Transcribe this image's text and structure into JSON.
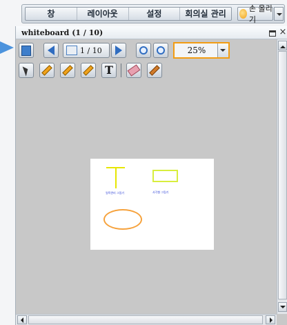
{
  "menu": {
    "items": [
      {
        "label": "창"
      },
      {
        "label": "레이아웃"
      },
      {
        "label": "설정"
      },
      {
        "label": "회의실 관리"
      }
    ],
    "raise_hand_label": "손 올리기"
  },
  "panel": {
    "title": "whiteboard (1 / 10)"
  },
  "toolbar": {
    "page_indicator": "1 / 10",
    "zoom_value": "25%",
    "zoom_highlight_color": "#f39c12",
    "text_tool_glyph": "T"
  },
  "canvas": {
    "labels": {
      "left": "일욕관리 그림기",
      "right": "사각형 그림기"
    },
    "colors": {
      "t_shape": "#e6e600",
      "rectangle": "#d8ee3e",
      "ellipse": "#f6a23c",
      "label_text": "#2b3fd6"
    }
  },
  "icons": {
    "pointer": "arrow-pointer-icon",
    "doc": "document-icon",
    "prev": "prev-page-icon",
    "next": "next-page-icon",
    "zoom_out": "zoom-out-icon",
    "zoom_in": "zoom-in-icon",
    "pen": "pen-icon",
    "highlighter": "highlighter-icon",
    "line": "line-icon",
    "text": "text-icon",
    "eraser": "eraser-icon",
    "brush": "brush-icon"
  }
}
